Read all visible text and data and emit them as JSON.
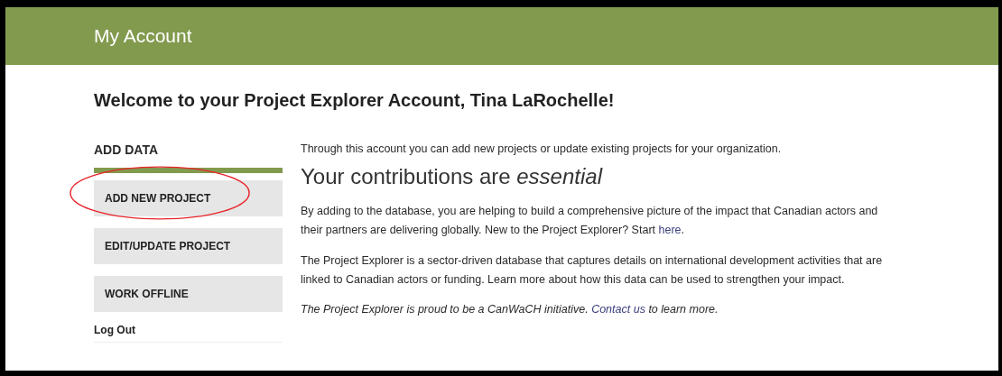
{
  "header": {
    "title": "My Account"
  },
  "welcome": "Welcome to your Project Explorer Account, Tina LaRochelle!",
  "sidebar": {
    "heading": "ADD DATA",
    "buttons": [
      {
        "label": "ADD NEW PROJECT",
        "circled": true
      },
      {
        "label": "EDIT/UPDATE PROJECT",
        "circled": false
      },
      {
        "label": "WORK OFFLINE",
        "circled": false
      }
    ],
    "logout": "Log Out"
  },
  "content": {
    "intro": "Through this account you can add new projects or update existing projects for your organization.",
    "heading": "Your contributions are *essential*",
    "paragraphs": [
      {
        "before": "By adding to the database, you are helping to build a comprehensive picture of the impact that Canadian actors and their partners are delivering globally. New to the Project Explorer? Start ",
        "link": "here",
        "after": ".",
        "italic": false
      },
      {
        "before": "The Project Explorer is a sector-driven database that captures details on international development activities that are linked to Canadian actors or funding. Learn more about how this data can be used to strengthen your impact.",
        "italic": false
      },
      {
        "before": "The Project Explorer is proud to be a CanWaCH initiative. ",
        "link": "Contact us",
        "after": " to learn more.",
        "italic": true
      }
    ]
  }
}
